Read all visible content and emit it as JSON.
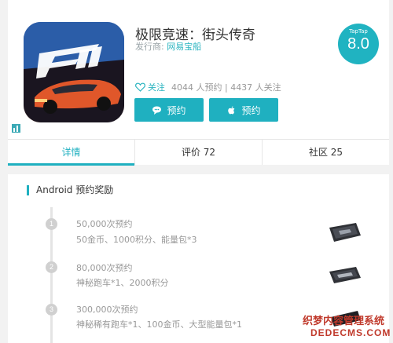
{
  "app": {
    "title": "极限竞速：街头传奇",
    "publisher_label": "发行商:",
    "publisher_name": "网易宝船",
    "score_brand": "TapTap",
    "score": "8.0"
  },
  "meta": {
    "follow_label": "关注",
    "stats": "4044 人预约 | 4437 人关注"
  },
  "buttons": {
    "android_reserve": "预约",
    "ios_reserve": "预约"
  },
  "tabs": [
    {
      "label": "详情"
    },
    {
      "label": "评价 72"
    },
    {
      "label": "社区 25"
    }
  ],
  "reward": {
    "title": "Android 预约奖励",
    "steps": [
      {
        "num": "1",
        "title": "50,000次预约",
        "desc": "50金币、1000积分、能量包*3"
      },
      {
        "num": "2",
        "title": "80,000次预约",
        "desc": "神秘跑车*1、2000积分"
      },
      {
        "num": "3",
        "title": "300,000次预约",
        "desc": "神秘稀有跑车*1、100金币、大型能量包*1"
      }
    ]
  },
  "watermark": {
    "line1": "织梦内容管理系统",
    "line2": "DEDECMS.COM"
  },
  "colors": {
    "accent": "#1fb0c0",
    "watermark": "#c0392b"
  }
}
